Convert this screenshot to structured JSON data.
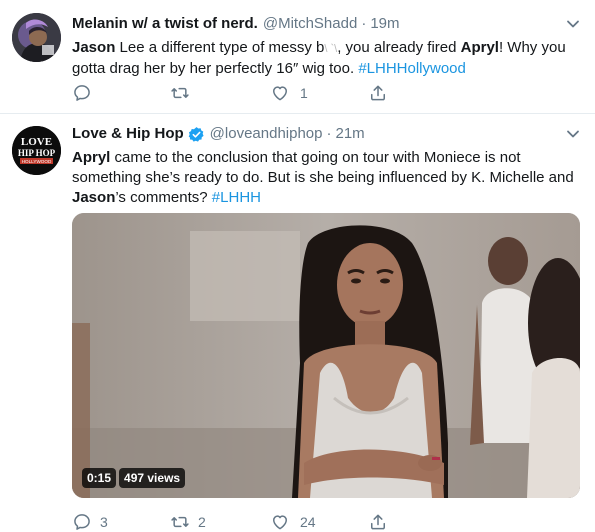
{
  "tweets": [
    {
      "display_name": "Melanin w/ a twist of nerd.",
      "handle": "@MitchShadd",
      "separator": "·",
      "time": "19m",
      "avatar_icon": "profile-avatar-icon",
      "text": {
        "mention_1": "Jason",
        "part_1": " Lee a different type of messy b",
        "obscured": "\\  `\\",
        "part_2": ", you already fired ",
        "mention_2": "Apryl",
        "part_3": "! Why you gotta drag her by her perfectly 16″ wig too. ",
        "hashtag": "#LHHHollywood"
      },
      "actions": {
        "reply_count": "",
        "retweet_count": "",
        "like_count": "1"
      }
    },
    {
      "display_name": "Love & Hip Hop",
      "verified": true,
      "handle": "@loveandhiphop",
      "separator": "·",
      "time": "21m",
      "avatar_logo": {
        "line_1": "LOVE",
        "line_2": "HIP HOP",
        "line_3": "HOLLYWOOD"
      },
      "text": {
        "mention_1": "Apryl",
        "part_1": " came to the conclusion that going on tour with Moniece is not something she’s ready to do. But is she being influenced by K. Michelle and ",
        "mention_2": "Jason",
        "part_2": "’s comments? ",
        "hashtag": "#LHHH"
      },
      "video": {
        "duration": "0:15",
        "views": "497 views"
      },
      "actions": {
        "reply_count": "3",
        "retweet_count": "2",
        "like_count": "24"
      }
    }
  ],
  "colors": {
    "link": "#1b95e0",
    "secondary_text": "#657786",
    "verified": "#1da1f2",
    "divider": "#e6ecf0"
  }
}
